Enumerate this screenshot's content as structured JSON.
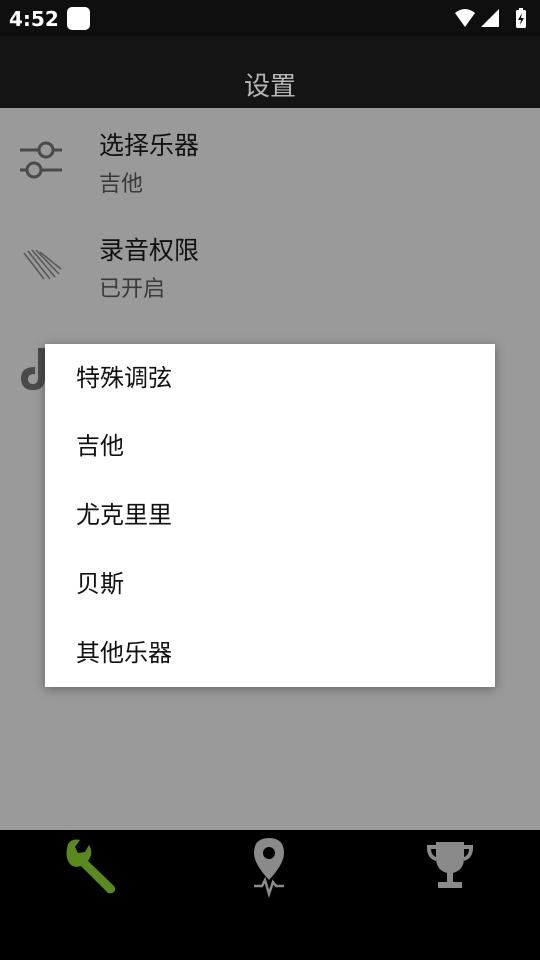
{
  "status_bar": {
    "time": "4:52",
    "icons": [
      "notification-icon",
      "wifi-icon",
      "signal-icon",
      "battery-icon"
    ]
  },
  "app_bar": {
    "title": "设置"
  },
  "settings": {
    "items": [
      {
        "icon": "sliders-icon",
        "label": "选择乐器",
        "value": "吉他"
      },
      {
        "icon": "mic-lines-icon",
        "label": "录音权限",
        "value": "已开启"
      },
      {
        "icon": "music-note-icon",
        "label": "",
        "value": ""
      }
    ]
  },
  "dialog": {
    "options": [
      "特殊调弦",
      "吉他",
      "尤克里里",
      "贝斯",
      "其他乐器"
    ]
  },
  "bottom_nav": {
    "tabs": [
      {
        "icon": "wrench-icon",
        "active": true
      },
      {
        "icon": "location-pulse-icon",
        "active": false
      },
      {
        "icon": "trophy-icon",
        "active": false
      }
    ],
    "active_color": "#5a8a1e",
    "inactive_color": "#8a8a8a"
  },
  "colors": {
    "scrim": "#9a9a9a",
    "appbar": "#141414",
    "statusbar": "#0f0f0f"
  }
}
